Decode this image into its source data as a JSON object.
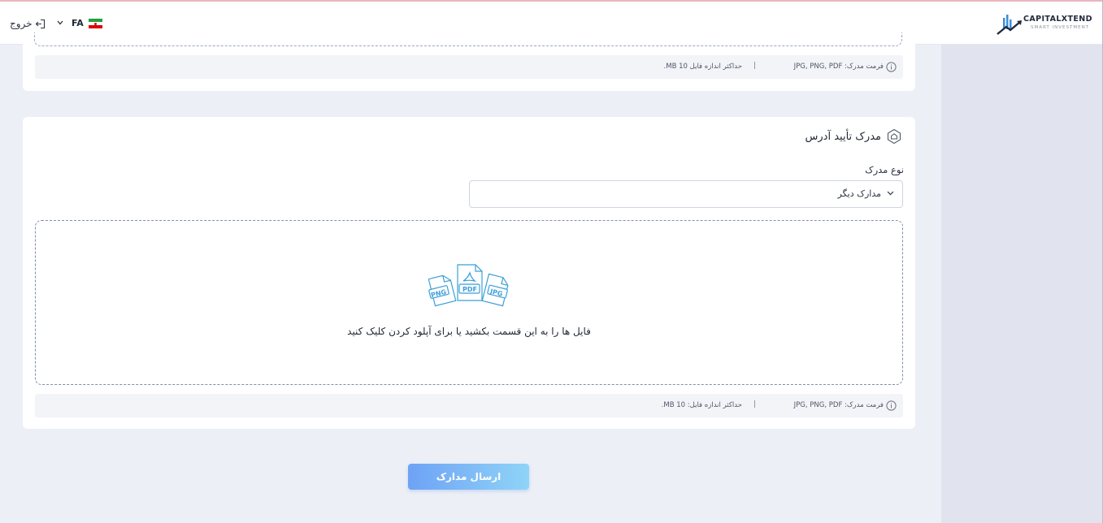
{
  "header": {
    "brand": "CAPITALXTEND",
    "tagline": "SMART INVESTMENT",
    "language_code": "FA",
    "logout_label": "خروج"
  },
  "top_card": {
    "format_text": "فرمت مدرک: JPG, PNG, PDF",
    "separator": "|",
    "max_size_text": "حداکثر اندازه فایل 10 MB."
  },
  "address_card": {
    "title": "مدرک تأیید آدرس",
    "doc_type_label": "نوع مدرک",
    "doc_type_value": "مدارک دیگر",
    "dropzone_text": "فایل ها را به این قسمت بکشید یا برای آپلود کردن کلیک کنید",
    "file_badges": [
      "PNG",
      "PDF",
      "JPG"
    ],
    "format_text": "فرمت مدرک: JPG, PNG, PDF",
    "separator": "|",
    "max_size_text": "حداکثر اندازه فایل: 10 MB."
  },
  "submit_label": "ارسال مدارک",
  "colors": {
    "accent_start": "#6ea2f5",
    "accent_end": "#8fd4f8",
    "file_icon_blue": "#3b9fd8",
    "page_bg": "#eceff6"
  }
}
